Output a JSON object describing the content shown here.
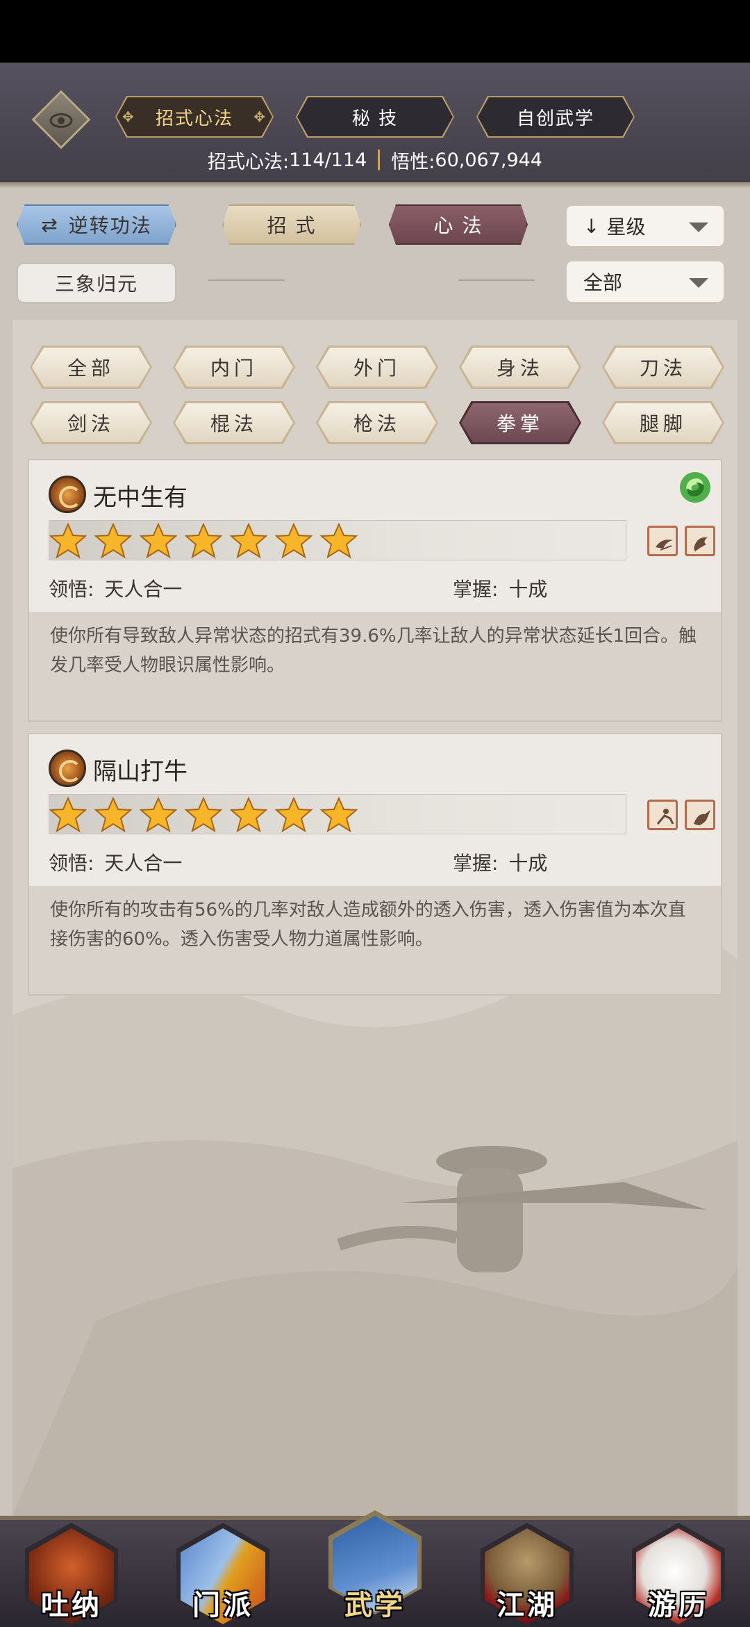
{
  "header": {
    "tabs": [
      {
        "label": "招式心法",
        "active": true
      },
      {
        "label": "秘 技",
        "active": false
      },
      {
        "label": "自创武学",
        "active": false
      }
    ],
    "stats": {
      "skills_label": "招式心法:",
      "skills_value": "114/114",
      "comprehension_label": "悟性:",
      "comprehension_value": "60,067,944"
    }
  },
  "filters": {
    "reverse_button": "逆转功法",
    "sanxiang_button": "三象归元",
    "mode_tabs": [
      {
        "label": "招 式",
        "active": false
      },
      {
        "label": "心 法",
        "active": true
      }
    ],
    "sort_dropdown": "星级",
    "scope_dropdown": "全部"
  },
  "categories": [
    {
      "label": "全部",
      "active": false
    },
    {
      "label": "内门",
      "active": false
    },
    {
      "label": "外门",
      "active": false
    },
    {
      "label": "身法",
      "active": false
    },
    {
      "label": "刀法",
      "active": false
    },
    {
      "label": "剑法",
      "active": false
    },
    {
      "label": "棍法",
      "active": false
    },
    {
      "label": "枪法",
      "active": false
    },
    {
      "label": "拳掌",
      "active": true
    },
    {
      "label": "腿脚",
      "active": false
    }
  ],
  "skills": [
    {
      "name": "无中生有",
      "stars": 7,
      "comprehension_label": "领悟:",
      "comprehension_value": "天人合一",
      "mastery_label": "掌握:",
      "mastery_value": "十成",
      "description": "使你所有导致敌人异常状态的招式有39.6%几率让敌人的异常状态延长1回合。触发几率受人物眼识属性影响。"
    },
    {
      "name": "隔山打牛",
      "stars": 7,
      "comprehension_label": "领悟:",
      "comprehension_value": "天人合一",
      "mastery_label": "掌握:",
      "mastery_value": "十成",
      "description": "使你所有的攻击有56%的几率对敌人造成额外的透入伤害，透入伤害值为本次直接伤害的60%。透入伤害受人物力道属性影响。"
    }
  ],
  "bottom_nav": [
    {
      "label": "吐纳",
      "icon": "monk-icon",
      "active": false
    },
    {
      "label": "门派",
      "icon": "sect-flags-icon",
      "active": false
    },
    {
      "label": "武学",
      "icon": "book-icon",
      "active": true
    },
    {
      "label": "江湖",
      "icon": "straw-hat-icon",
      "active": false
    },
    {
      "label": "游历",
      "icon": "horse-icon",
      "active": false
    }
  ],
  "colors": {
    "header_bg": "#4a4652",
    "accent_gold": "#f3d88b",
    "active_tab": "#7a525b",
    "star_gold": "#f7b52a"
  }
}
